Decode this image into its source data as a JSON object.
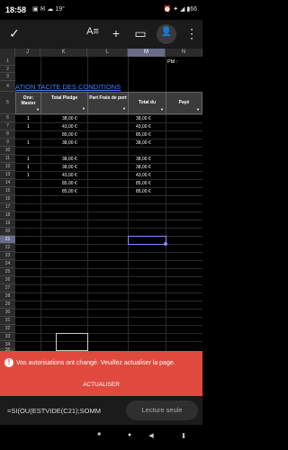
{
  "status": {
    "time": "18:58",
    "temperature": "19°",
    "battery": "66"
  },
  "toolbar": {
    "check": "✓",
    "format": "A≡",
    "add": "+",
    "comment": "▭",
    "share": "👤",
    "more": "⋮"
  },
  "sheet": {
    "columns": [
      "J",
      "K",
      "L",
      "M",
      "N"
    ],
    "rows": [
      "1",
      "2",
      "3",
      "4",
      "5",
      "6",
      "7",
      "8",
      "9",
      "10",
      "11",
      "12",
      "13",
      "14",
      "15",
      "16",
      "17",
      "18",
      "19",
      "20",
      "21",
      "22",
      "23",
      "24",
      "25",
      "26",
      "27",
      "28",
      "29",
      "30",
      "31",
      "32",
      "33",
      "34",
      "35"
    ],
    "pm_label": "PM :",
    "title": "ATION TACITE DES CONDITIONS",
    "headers": [
      "One: Master",
      "Total Pledge",
      "Part Frais de port",
      "Total du",
      "Payé"
    ],
    "data": [
      {
        "j": "1",
        "k": "38,00 €",
        "m": "38,00 €"
      },
      {
        "j": "1",
        "k": "43,00 €",
        "m": "43,00 €"
      },
      {
        "j": "",
        "k": "85,00 €",
        "m": "85,00 €"
      },
      {
        "j": "1",
        "k": "38,00 €",
        "m": "38,00 €"
      },
      {
        "j": "",
        "k": "",
        "m": ""
      },
      {
        "j": "1",
        "k": "38,00 €",
        "m": "38,00 €"
      },
      {
        "j": "1",
        "k": "38,00 €",
        "m": "38,00 €"
      },
      {
        "j": "1",
        "k": "43,00 €",
        "m": "43,00 €"
      },
      {
        "j": "",
        "k": "85,00 €",
        "m": "85,00 €"
      },
      {
        "j": "",
        "k": "85,00 €",
        "m": "85,00 €"
      }
    ]
  },
  "notice": {
    "message": "Vos autorisations ont changé. Veuillez actualiser la page.",
    "action": "ACTUALISER"
  },
  "formula": {
    "expression": "=SI(OU(ESTVIDE(C21);SOMM",
    "readonly_label": "Lecture seule"
  },
  "nav": {
    "back": "◀",
    "home": "●",
    "recents": "■",
    "down": "⬇"
  }
}
